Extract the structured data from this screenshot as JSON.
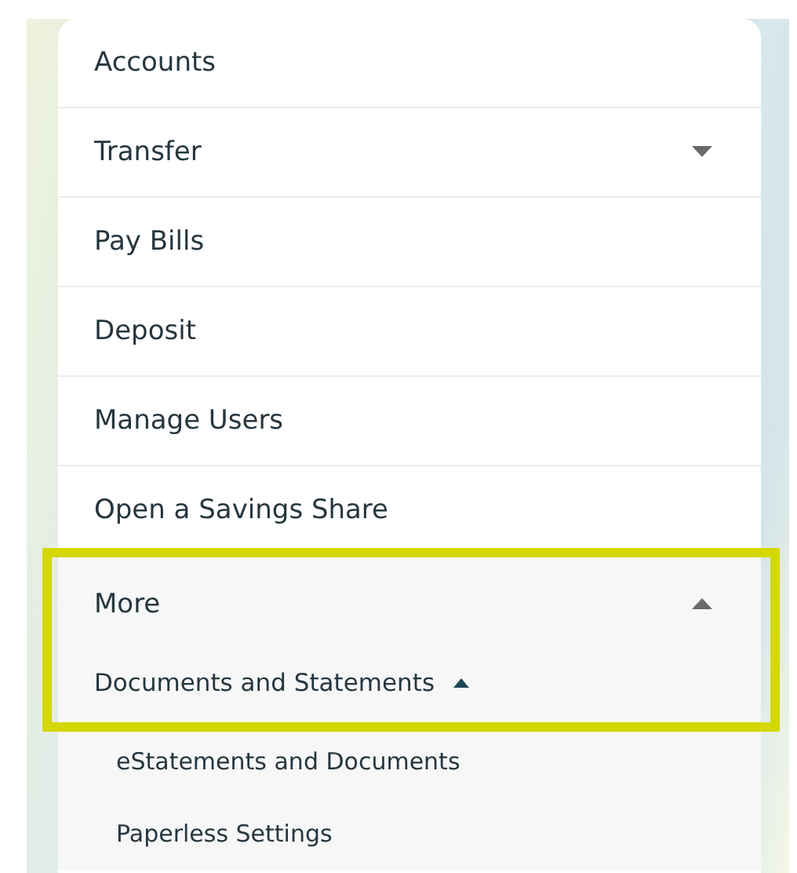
{
  "menu": {
    "items": [
      {
        "label": "Accounts",
        "kind": "link"
      },
      {
        "label": "Transfer",
        "kind": "dropdown",
        "expanded": false
      },
      {
        "label": "Pay Bills",
        "kind": "link"
      },
      {
        "label": "Deposit",
        "kind": "link"
      },
      {
        "label": "Manage Users",
        "kind": "link"
      },
      {
        "label": "Open a Savings Share",
        "kind": "link"
      },
      {
        "label": "More",
        "kind": "dropdown",
        "expanded": true,
        "highlighted": true,
        "children": [
          {
            "label": "Documents and Statements",
            "expanded": true,
            "children": [
              {
                "label": "eStatements and Documents"
              },
              {
                "label": "Paperless Settings"
              }
            ]
          }
        ]
      }
    ]
  }
}
